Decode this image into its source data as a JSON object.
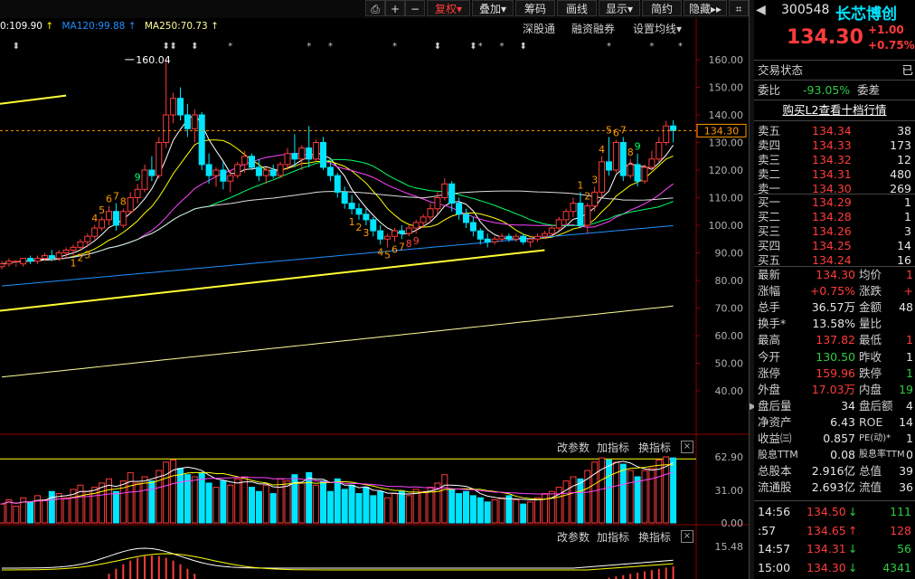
{
  "toolbar": {
    "buttons": [
      "复权",
      "叠加",
      "筹码",
      "画线",
      "显示",
      "简约",
      "隐藏"
    ],
    "fuquan_arrow": "▾",
    "hide_arrows": "▸▸"
  },
  "ma_legend": {
    "ma_prev": "0:109.90",
    "ma120": "MA120:99.88",
    "ma250": "MA250:70.73"
  },
  "header_links": [
    "深股通",
    "融资融券",
    "设置均线"
  ],
  "stock": {
    "code": "300548",
    "name": "长芯博创",
    "price": "134.30",
    "change": "+1.00",
    "change_pct": "+0.75%"
  },
  "right_panel": {
    "status_label": "交易状态",
    "status_value": "已",
    "weibi_label": "委比",
    "weibi_value": "-93.05%",
    "weicha_label": "委差",
    "l2_link": "购买L2查看十档行情",
    "asks": [
      {
        "label": "卖五",
        "price": "134.34",
        "vol": "38"
      },
      {
        "label": "卖四",
        "price": "134.33",
        "vol": "173"
      },
      {
        "label": "卖三",
        "price": "134.32",
        "vol": "12"
      },
      {
        "label": "卖二",
        "price": "134.31",
        "vol": "480"
      },
      {
        "label": "卖一",
        "price": "134.30",
        "vol": "269"
      }
    ],
    "bids": [
      {
        "label": "买一",
        "price": "134.29",
        "vol": "1"
      },
      {
        "label": "买二",
        "price": "134.28",
        "vol": "1"
      },
      {
        "label": "买三",
        "price": "134.26",
        "vol": "3"
      },
      {
        "label": "买四",
        "price": "134.25",
        "vol": "14"
      },
      {
        "label": "买五",
        "price": "134.24",
        "vol": "16"
      }
    ],
    "stats": [
      {
        "l1": "最新",
        "v1": "134.30",
        "c1": "red",
        "l2": "均价",
        "v2": "1",
        "c2": "red"
      },
      {
        "l1": "涨幅",
        "v1": "+0.75%",
        "c1": "red",
        "l2": "涨跌",
        "v2": "+",
        "c2": "red"
      },
      {
        "l1": "总手",
        "v1": "36.57万",
        "c1": "white",
        "l2": "金额",
        "v2": "48",
        "c2": "white"
      },
      {
        "l1": "换手*",
        "v1": "13.58%",
        "c1": "white",
        "l2": "量比",
        "v2": "",
        "c2": "white"
      },
      {
        "l1": "最高",
        "v1": "137.82",
        "c1": "red",
        "l2": "最低",
        "v2": "1",
        "c2": "red"
      },
      {
        "l1": "今开",
        "v1": "130.50",
        "c1": "green",
        "l2": "昨收",
        "v2": "1",
        "c2": "white"
      },
      {
        "l1": "涨停",
        "v1": "159.96",
        "c1": "red",
        "l2": "跌停",
        "v2": "1",
        "c2": "green"
      },
      {
        "l1": "外盘",
        "v1": "17.03万",
        "c1": "red",
        "l2": "内盘",
        "v2": "19",
        "c2": "green"
      },
      {
        "l1": "盘后量",
        "v1": "34",
        "c1": "white",
        "l2": "盘后额",
        "v2": "4",
        "c2": "white"
      },
      {
        "l1": "净资产",
        "v1": "6.43",
        "c1": "white",
        "l2": "ROE",
        "v2": "14",
        "c2": "white"
      },
      {
        "l1": "收益㈢",
        "v1": "0.857",
        "c1": "white",
        "l2": "PE(动)*",
        "v2": "1",
        "c2": "white"
      },
      {
        "l1": "股息TTM",
        "v1": "0.08",
        "c1": "white",
        "l2": "股息率TTM",
        "v2": "0",
        "c2": "white"
      },
      {
        "l1": "总股本",
        "v1": "2.916亿",
        "c1": "white",
        "l2": "总值",
        "v2": "39",
        "c2": "white"
      },
      {
        "l1": "流通股",
        "v1": "2.693亿",
        "c1": "white",
        "l2": "流值",
        "v2": "36",
        "c2": "white"
      }
    ],
    "ticks": [
      {
        "time": "14:56",
        "price": "134.50",
        "dir": "↓",
        "vol": "111",
        "color": "green"
      },
      {
        "time": ":57",
        "price": "134.65",
        "dir": "↑",
        "vol": "128",
        "color": "red"
      },
      {
        "time": "14:57",
        "price": "134.31",
        "dir": "↓",
        "vol": "56",
        "color": "green"
      },
      {
        "time": "15:00",
        "price": "134.30",
        "dir": "↓",
        "vol": "4341",
        "color": "green"
      }
    ]
  },
  "sub_panels": [
    {
      "buttons": [
        "改参数",
        "加指标",
        "换指标"
      ],
      "close": "×"
    },
    {
      "buttons": [
        "改参数",
        "加指标",
        "换指标"
      ],
      "close": "×"
    }
  ],
  "chart_data": {
    "type": "candlestick",
    "y_ticks": [
      "160.00",
      "150.00",
      "140.00",
      "130.00",
      "120.00",
      "110.00",
      "100.00",
      "90.00",
      "80.00",
      "70.00",
      "60.00",
      "50.00",
      "40.00"
    ],
    "ylim": [
      35,
      165
    ],
    "current_price": 134.3,
    "current_label": "134.30",
    "max_label": "160.04",
    "max_value": 160.04,
    "candles": [
      [
        85,
        87,
        84,
        86
      ],
      [
        86,
        88,
        85,
        87
      ],
      [
        87,
        86,
        85,
        87
      ],
      [
        86,
        88,
        85,
        88
      ],
      [
        88,
        89,
        86,
        87
      ],
      [
        87,
        89,
        86,
        88
      ],
      [
        88,
        90,
        87,
        89
      ],
      [
        89,
        91,
        87,
        88
      ],
      [
        88,
        91,
        87,
        90
      ],
      [
        90,
        92,
        88,
        91
      ],
      [
        91,
        93,
        89,
        92
      ],
      [
        92,
        95,
        91,
        94
      ],
      [
        94,
        97,
        92,
        96
      ],
      [
        96,
        100,
        95,
        99
      ],
      [
        99,
        103,
        98,
        102
      ],
      [
        102,
        107,
        100,
        105
      ],
      [
        105,
        108,
        98,
        100
      ],
      [
        100,
        106,
        99,
        105
      ],
      [
        105,
        112,
        104,
        110
      ],
      [
        110,
        115,
        108,
        113
      ],
      [
        113,
        122,
        112,
        120
      ],
      [
        120,
        125,
        116,
        118
      ],
      [
        118,
        132,
        117,
        130
      ],
      [
        130,
        160.04,
        128,
        140
      ],
      [
        140,
        148,
        137,
        146
      ],
      [
        146,
        150,
        138,
        140
      ],
      [
        140,
        144,
        132,
        135
      ],
      [
        135,
        142,
        130,
        140
      ],
      [
        140,
        141,
        120,
        122
      ],
      [
        122,
        126,
        115,
        118
      ],
      [
        118,
        121,
        114,
        120
      ],
      [
        120,
        123,
        113,
        116
      ],
      [
        116,
        120,
        112,
        118
      ],
      [
        118,
        123,
        117,
        122
      ],
      [
        122,
        127,
        119,
        125
      ],
      [
        125,
        126,
        120,
        121
      ],
      [
        121,
        124,
        116,
        118
      ],
      [
        118,
        121,
        115,
        120
      ],
      [
        120,
        122,
        117,
        118
      ],
      [
        118,
        123,
        117,
        122
      ],
      [
        122,
        128,
        120,
        126
      ],
      [
        126,
        133,
        121,
        124
      ],
      [
        124,
        129,
        120,
        128
      ],
      [
        128,
        136,
        121,
        124
      ],
      [
        124,
        131,
        123,
        130
      ],
      [
        130,
        132,
        120,
        121
      ],
      [
        121,
        123,
        116,
        118
      ],
      [
        118,
        119,
        110,
        112
      ],
      [
        112,
        114,
        106,
        108
      ],
      [
        108,
        111,
        104,
        106
      ],
      [
        106,
        108,
        102,
        104
      ],
      [
        104,
        106,
        100,
        102
      ],
      [
        102,
        103,
        96,
        98
      ],
      [
        98,
        100,
        93,
        95
      ],
      [
        95,
        97,
        92,
        96
      ],
      [
        96,
        99,
        94,
        98
      ],
      [
        98,
        100,
        95,
        97
      ],
      [
        97,
        100,
        96,
        99
      ],
      [
        99,
        102,
        97,
        101
      ],
      [
        101,
        104,
        99,
        103
      ],
      [
        103,
        108,
        101,
        106
      ],
      [
        106,
        112,
        104,
        110
      ],
      [
        110,
        117,
        109,
        115
      ],
      [
        115,
        116,
        105,
        108
      ],
      [
        108,
        110,
        102,
        104
      ],
      [
        104,
        106,
        99,
        101
      ],
      [
        101,
        103,
        96,
        98
      ],
      [
        98,
        99,
        93,
        95
      ],
      [
        95,
        97,
        92,
        94
      ],
      [
        94,
        96,
        93,
        95
      ],
      [
        95,
        97,
        94,
        96
      ],
      [
        96,
        97,
        94,
        95
      ],
      [
        95,
        97,
        94,
        96
      ],
      [
        96,
        97,
        93,
        94
      ],
      [
        94,
        96,
        92,
        95
      ],
      [
        95,
        97,
        94,
        96
      ],
      [
        96,
        98,
        95,
        97
      ],
      [
        97,
        100,
        96,
        99
      ],
      [
        99,
        103,
        98,
        102
      ],
      [
        102,
        106,
        100,
        105
      ],
      [
        105,
        110,
        103,
        108
      ],
      [
        108,
        112,
        99,
        100
      ],
      [
        100,
        108,
        97,
        107
      ],
      [
        107,
        114,
        105,
        112
      ],
      [
        112,
        125,
        110,
        123
      ],
      [
        123,
        132,
        118,
        120
      ],
      [
        120,
        131,
        119,
        130
      ],
      [
        130,
        132,
        116,
        118
      ],
      [
        118,
        124,
        117,
        122
      ],
      [
        122,
        126,
        114,
        116
      ],
      [
        116,
        122,
        115,
        121
      ],
      [
        121,
        127,
        120,
        124
      ],
      [
        124,
        132,
        123,
        130
      ],
      [
        130,
        137.82,
        129,
        136
      ],
      [
        136,
        138,
        130,
        134.3
      ]
    ],
    "volumes": [
      18,
      22,
      16,
      24,
      20,
      26,
      22,
      30,
      28,
      24,
      32,
      36,
      30,
      34,
      38,
      42,
      30,
      40,
      48,
      38,
      44,
      40,
      50,
      58,
      60,
      52,
      46,
      44,
      48,
      38,
      34,
      40,
      36,
      42,
      44,
      34,
      30,
      36,
      28,
      42,
      40,
      46,
      38,
      48,
      36,
      40,
      30,
      42,
      32,
      36,
      28,
      34,
      26,
      30,
      24,
      28,
      30,
      26,
      32,
      30,
      34,
      38,
      46,
      32,
      28,
      30,
      26,
      24,
      20,
      22,
      24,
      26,
      22,
      18,
      20,
      24,
      28,
      30,
      34,
      40,
      44,
      42,
      50,
      58,
      62,
      60,
      58,
      56,
      50,
      44,
      50,
      52,
      60,
      63,
      62
    ],
    "vol_ticks": [
      "62.90",
      "31.00",
      "0.00"
    ],
    "vol_max": 63,
    "macd_tick": "15.48",
    "signal_numbers": [
      {
        "i": 10,
        "t": "1",
        "c": "orange",
        "above": false
      },
      {
        "i": 11,
        "t": "2",
        "c": "orange",
        "above": false
      },
      {
        "i": 12,
        "t": "3",
        "c": "orange",
        "above": false
      },
      {
        "i": 13,
        "t": "4",
        "c": "orange",
        "above": true
      },
      {
        "i": 14,
        "t": "5",
        "c": "orange",
        "above": true
      },
      {
        "i": 15,
        "t": "6",
        "c": "orange",
        "above": true
      },
      {
        "i": 16,
        "t": "7",
        "c": "orange",
        "above": true
      },
      {
        "i": 17,
        "t": "8",
        "c": "orange",
        "above": true
      },
      {
        "i": 19,
        "t": "9",
        "c": "green",
        "above": true
      },
      {
        "i": 49,
        "t": "1",
        "c": "orange",
        "above": false
      },
      {
        "i": 50,
        "t": "2",
        "c": "orange",
        "above": false
      },
      {
        "i": 51,
        "t": "3",
        "c": "orange",
        "above": false
      },
      {
        "i": 53,
        "t": "4",
        "c": "orange",
        "above": false
      },
      {
        "i": 54,
        "t": "5",
        "c": "orange",
        "above": false
      },
      {
        "i": 55,
        "t": "6",
        "c": "orange",
        "above": false
      },
      {
        "i": 56,
        "t": "7",
        "c": "orange",
        "above": false
      },
      {
        "i": 57,
        "t": "8",
        "c": "red",
        "above": false
      },
      {
        "i": 58,
        "t": "9",
        "c": "red",
        "above": false
      },
      {
        "i": 81,
        "t": "1",
        "c": "orange",
        "above": true
      },
      {
        "i": 82,
        "t": "2",
        "c": "orange",
        "above": true
      },
      {
        "i": 83,
        "t": "3",
        "c": "orange",
        "above": true
      },
      {
        "i": 84,
        "t": "4",
        "c": "orange",
        "above": true
      },
      {
        "i": 85,
        "t": "5",
        "c": "orange",
        "above": true
      },
      {
        "i": 86,
        "t": "6",
        "c": "orange",
        "above": true
      },
      {
        "i": 87,
        "t": "7",
        "c": "orange",
        "above": true
      },
      {
        "i": 88,
        "t": "8",
        "c": "orange",
        "above": true
      },
      {
        "i": 89,
        "t": "9",
        "c": "green",
        "above": true
      }
    ],
    "event_markers": [
      {
        "i": 2,
        "t": "⬍"
      },
      {
        "i": 23,
        "t": "⬍"
      },
      {
        "i": 24,
        "t": "⬍"
      },
      {
        "i": 27,
        "t": "⬍"
      },
      {
        "i": 32,
        "t": "*"
      },
      {
        "i": 43,
        "t": "*"
      },
      {
        "i": 46,
        "t": "*"
      },
      {
        "i": 55,
        "t": "*"
      },
      {
        "i": 61,
        "t": "⬍"
      },
      {
        "i": 66,
        "t": "⬍"
      },
      {
        "i": 67,
        "t": "*"
      },
      {
        "i": 70,
        "t": "*"
      },
      {
        "i": 73,
        "t": "⬍"
      },
      {
        "i": 85,
        "t": "*"
      },
      {
        "i": 91,
        "t": "*"
      },
      {
        "i": 95,
        "t": "*"
      }
    ],
    "colors": {
      "up": "#ff3b3b",
      "down": "#00e5ff",
      "ma5": "#ffffff",
      "ma10": "#ffff00",
      "ma20": "#ff44ff",
      "ma30": "#00ff66",
      "ma60": "#dddddd",
      "ma120": "#1e90ff",
      "ma250": "#ffff99",
      "trend": "#ffff33"
    }
  }
}
